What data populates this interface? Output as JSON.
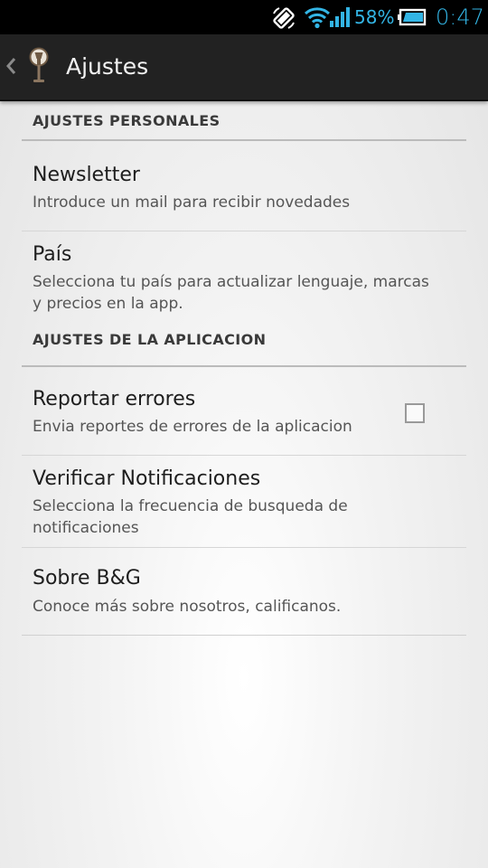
{
  "status_bar": {
    "battery_percent": "58%",
    "time": "0:47",
    "accent_color": "#33b5e5",
    "icons": [
      "screen-rotation-icon",
      "wifi-icon",
      "signal-icon",
      "battery-icon"
    ]
  },
  "action_bar": {
    "title": "Ajustes",
    "icons": [
      "chevron-left-icon",
      "app-logo-icon"
    ]
  },
  "settings": {
    "personal": {
      "header": "AJUSTES PERSONALES",
      "items": [
        {
          "title": "Newsletter",
          "summary": "Introduce un mail para recibir novedades"
        },
        {
          "title": "País",
          "summary": "Selecciona tu país para actualizar lenguaje, marcas y precios en la app."
        }
      ]
    },
    "app": {
      "header": "AJUSTES DE LA APLICACION",
      "items": [
        {
          "title": "Reportar errores",
          "summary": "Envia reportes de errores de la aplicacion",
          "checked": false
        },
        {
          "title": "Verificar Notificaciones",
          "summary": "Selecciona la frecuencia de busqueda de notificaciones"
        },
        {
          "title": "Sobre B&G",
          "summary": "Conoce más sobre nosotros, calificanos."
        }
      ]
    }
  }
}
